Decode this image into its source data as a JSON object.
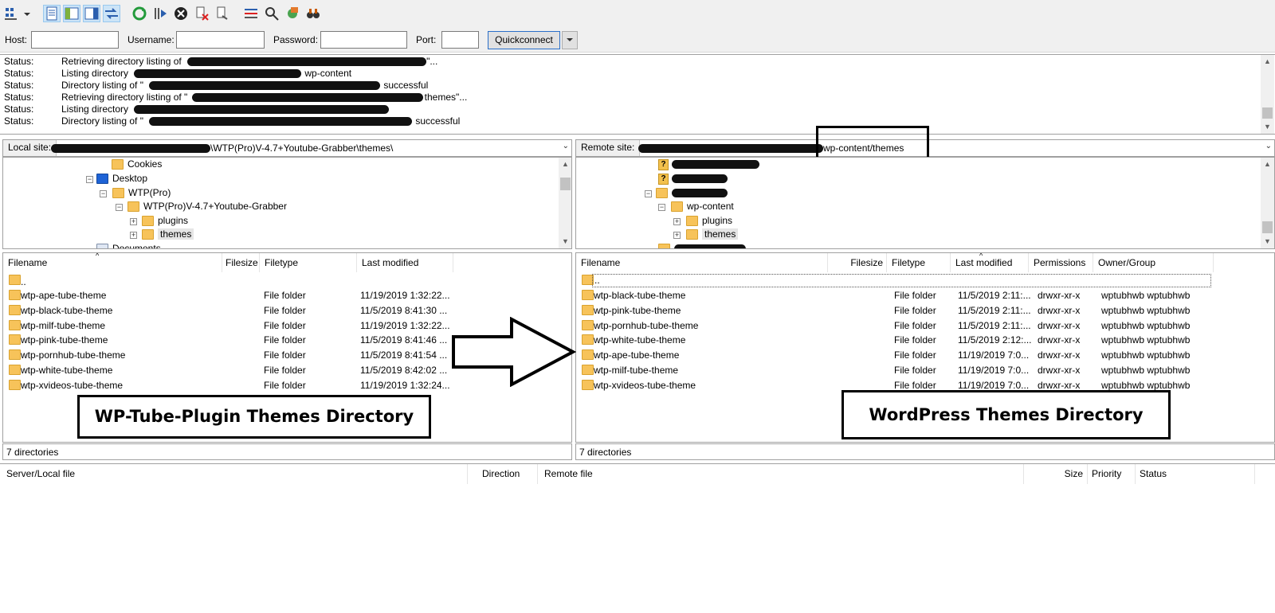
{
  "toolbar": {
    "icons": [
      "site-manager-icon",
      "toggle-log-icon",
      "toggle-local-tree-icon",
      "toggle-remote-tree-icon",
      "toggle-queue-icon",
      "refresh-icon",
      "process-queue-icon",
      "cancel-icon",
      "disconnect-icon",
      "reconnect-icon",
      "filter-icon",
      "compare-icon",
      "sync-browse-icon",
      "search-icon"
    ]
  },
  "quickconnect": {
    "host_label": "Host:",
    "username_label": "Username:",
    "password_label": "Password:",
    "port_label": "Port:",
    "button_label": "Quickconnect"
  },
  "log": [
    {
      "type": "Status:",
      "prefix": "Retrieving directory listing of",
      "suffix": "\"..."
    },
    {
      "type": "Status:",
      "prefix": "Listing directory",
      "suffix": "wp-content"
    },
    {
      "type": "Status:",
      "prefix": "Directory listing of \"",
      "suffix": "successful"
    },
    {
      "type": "Status:",
      "prefix": "Retrieving directory listing of \"",
      "suffix": "themes\"..."
    },
    {
      "type": "Status:",
      "prefix": "Listing directory",
      "suffix": ""
    },
    {
      "type": "Status:",
      "prefix": "Directory listing of \"",
      "suffix": "successful"
    }
  ],
  "local": {
    "site_label": "Local site:",
    "path": "\\WTP(Pro)V-4.7+Youtube-Grabber\\themes\\",
    "tree": [
      "Cookies",
      "Desktop",
      "WTP(Pro)",
      "WTP(Pro)V-4.7+Youtube-Grabber",
      "plugins",
      "themes",
      "Documents"
    ],
    "columns": [
      "Filename",
      "Filesize",
      "Filetype",
      "Last modified"
    ],
    "parent": "..",
    "files": [
      {
        "name": "wtp-ape-tube-theme",
        "type": "File folder",
        "modified": "11/19/2019 1:32:22..."
      },
      {
        "name": "wtp-black-tube-theme",
        "type": "File folder",
        "modified": "11/5/2019 8:41:30 ..."
      },
      {
        "name": "wtp-milf-tube-theme",
        "type": "File folder",
        "modified": "11/19/2019 1:32:22..."
      },
      {
        "name": "wtp-pink-tube-theme",
        "type": "File folder",
        "modified": "11/5/2019 8:41:46 ..."
      },
      {
        "name": "wtp-pornhub-tube-theme",
        "type": "File folder",
        "modified": "11/5/2019 8:41:54 ..."
      },
      {
        "name": "wtp-white-tube-theme",
        "type": "File folder",
        "modified": "11/5/2019 8:42:02 ..."
      },
      {
        "name": "wtp-xvideos-tube-theme",
        "type": "File folder",
        "modified": "11/19/2019 1:32:24..."
      }
    ],
    "status": "7 directories"
  },
  "remote": {
    "site_label": "Remote site:",
    "path": "wp-content/themes",
    "tree": [
      "wp-content",
      "plugins",
      "themes"
    ],
    "columns": [
      "Filename",
      "Filesize",
      "Filetype",
      "Last modified",
      "Permissions",
      "Owner/Group"
    ],
    "parent": "..",
    "files": [
      {
        "name": "wtp-black-tube-theme",
        "type": "File folder",
        "modified": "11/5/2019 2:11:...",
        "perms": "drwxr-xr-x",
        "owner": "wptubhwb wptubhwb"
      },
      {
        "name": "wtp-pink-tube-theme",
        "type": "File folder",
        "modified": "11/5/2019 2:11:...",
        "perms": "drwxr-xr-x",
        "owner": "wptubhwb wptubhwb"
      },
      {
        "name": "wtp-pornhub-tube-theme",
        "type": "File folder",
        "modified": "11/5/2019 2:11:...",
        "perms": "drwxr-xr-x",
        "owner": "wptubhwb wptubhwb"
      },
      {
        "name": "wtp-white-tube-theme",
        "type": "File folder",
        "modified": "11/5/2019 2:12:...",
        "perms": "drwxr-xr-x",
        "owner": "wptubhwb wptubhwb"
      },
      {
        "name": "wtp-ape-tube-theme",
        "type": "File folder",
        "modified": "11/19/2019 7:0...",
        "perms": "drwxr-xr-x",
        "owner": "wptubhwb wptubhwb"
      },
      {
        "name": "wtp-milf-tube-theme",
        "type": "File folder",
        "modified": "11/19/2019 7:0...",
        "perms": "drwxr-xr-x",
        "owner": "wptubhwb wptubhwb"
      },
      {
        "name": "wtp-xvideos-tube-theme",
        "type": "File folder",
        "modified": "11/19/2019 7:0...",
        "perms": "drwxr-xr-x",
        "owner": "wptubhwb wptubhwb"
      }
    ],
    "status": "7 directories"
  },
  "queue": {
    "columns": [
      "Server/Local file",
      "Direction",
      "Remote file",
      "Size",
      "Priority",
      "Status"
    ]
  },
  "annotations": {
    "left": "WP-Tube-Plugin Themes Directory",
    "right": "WordPress Themes Directory"
  }
}
